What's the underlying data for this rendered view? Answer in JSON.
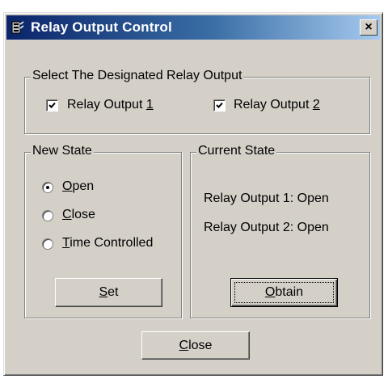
{
  "window": {
    "title": "Relay Output Control",
    "close_glyph": "×"
  },
  "relay_select": {
    "legend": "Select The Designated Relay Output",
    "relay1": {
      "pre": "Relay Output ",
      "mnemonic": "1",
      "checked": true
    },
    "relay2": {
      "pre": "Relay Output ",
      "mnemonic": "2",
      "checked": true
    }
  },
  "new_state": {
    "legend": "New State",
    "options": [
      {
        "mnemonic": "O",
        "rest": "pen",
        "selected": true
      },
      {
        "mnemonic": "C",
        "rest": "lose",
        "selected": false
      },
      {
        "mnemonic": "T",
        "rest": "ime Controlled",
        "selected": false
      }
    ],
    "set_button": {
      "mnemonic": "S",
      "rest": "et"
    }
  },
  "current_state": {
    "legend": "Current State",
    "relay1_status": "Relay Output 1: Open",
    "relay2_status": "Relay Output 2: Open",
    "obtain_button": {
      "mnemonic": "O",
      "rest": "btain"
    }
  },
  "close_button": {
    "mnemonic": "C",
    "rest": "lose"
  },
  "icons": {
    "app": "relay-app-icon",
    "check": "checkmark-icon"
  },
  "colors": {
    "dialog_bg": "#d4d0c8",
    "title_start": "#0a246a",
    "title_end": "#a6caf0"
  }
}
